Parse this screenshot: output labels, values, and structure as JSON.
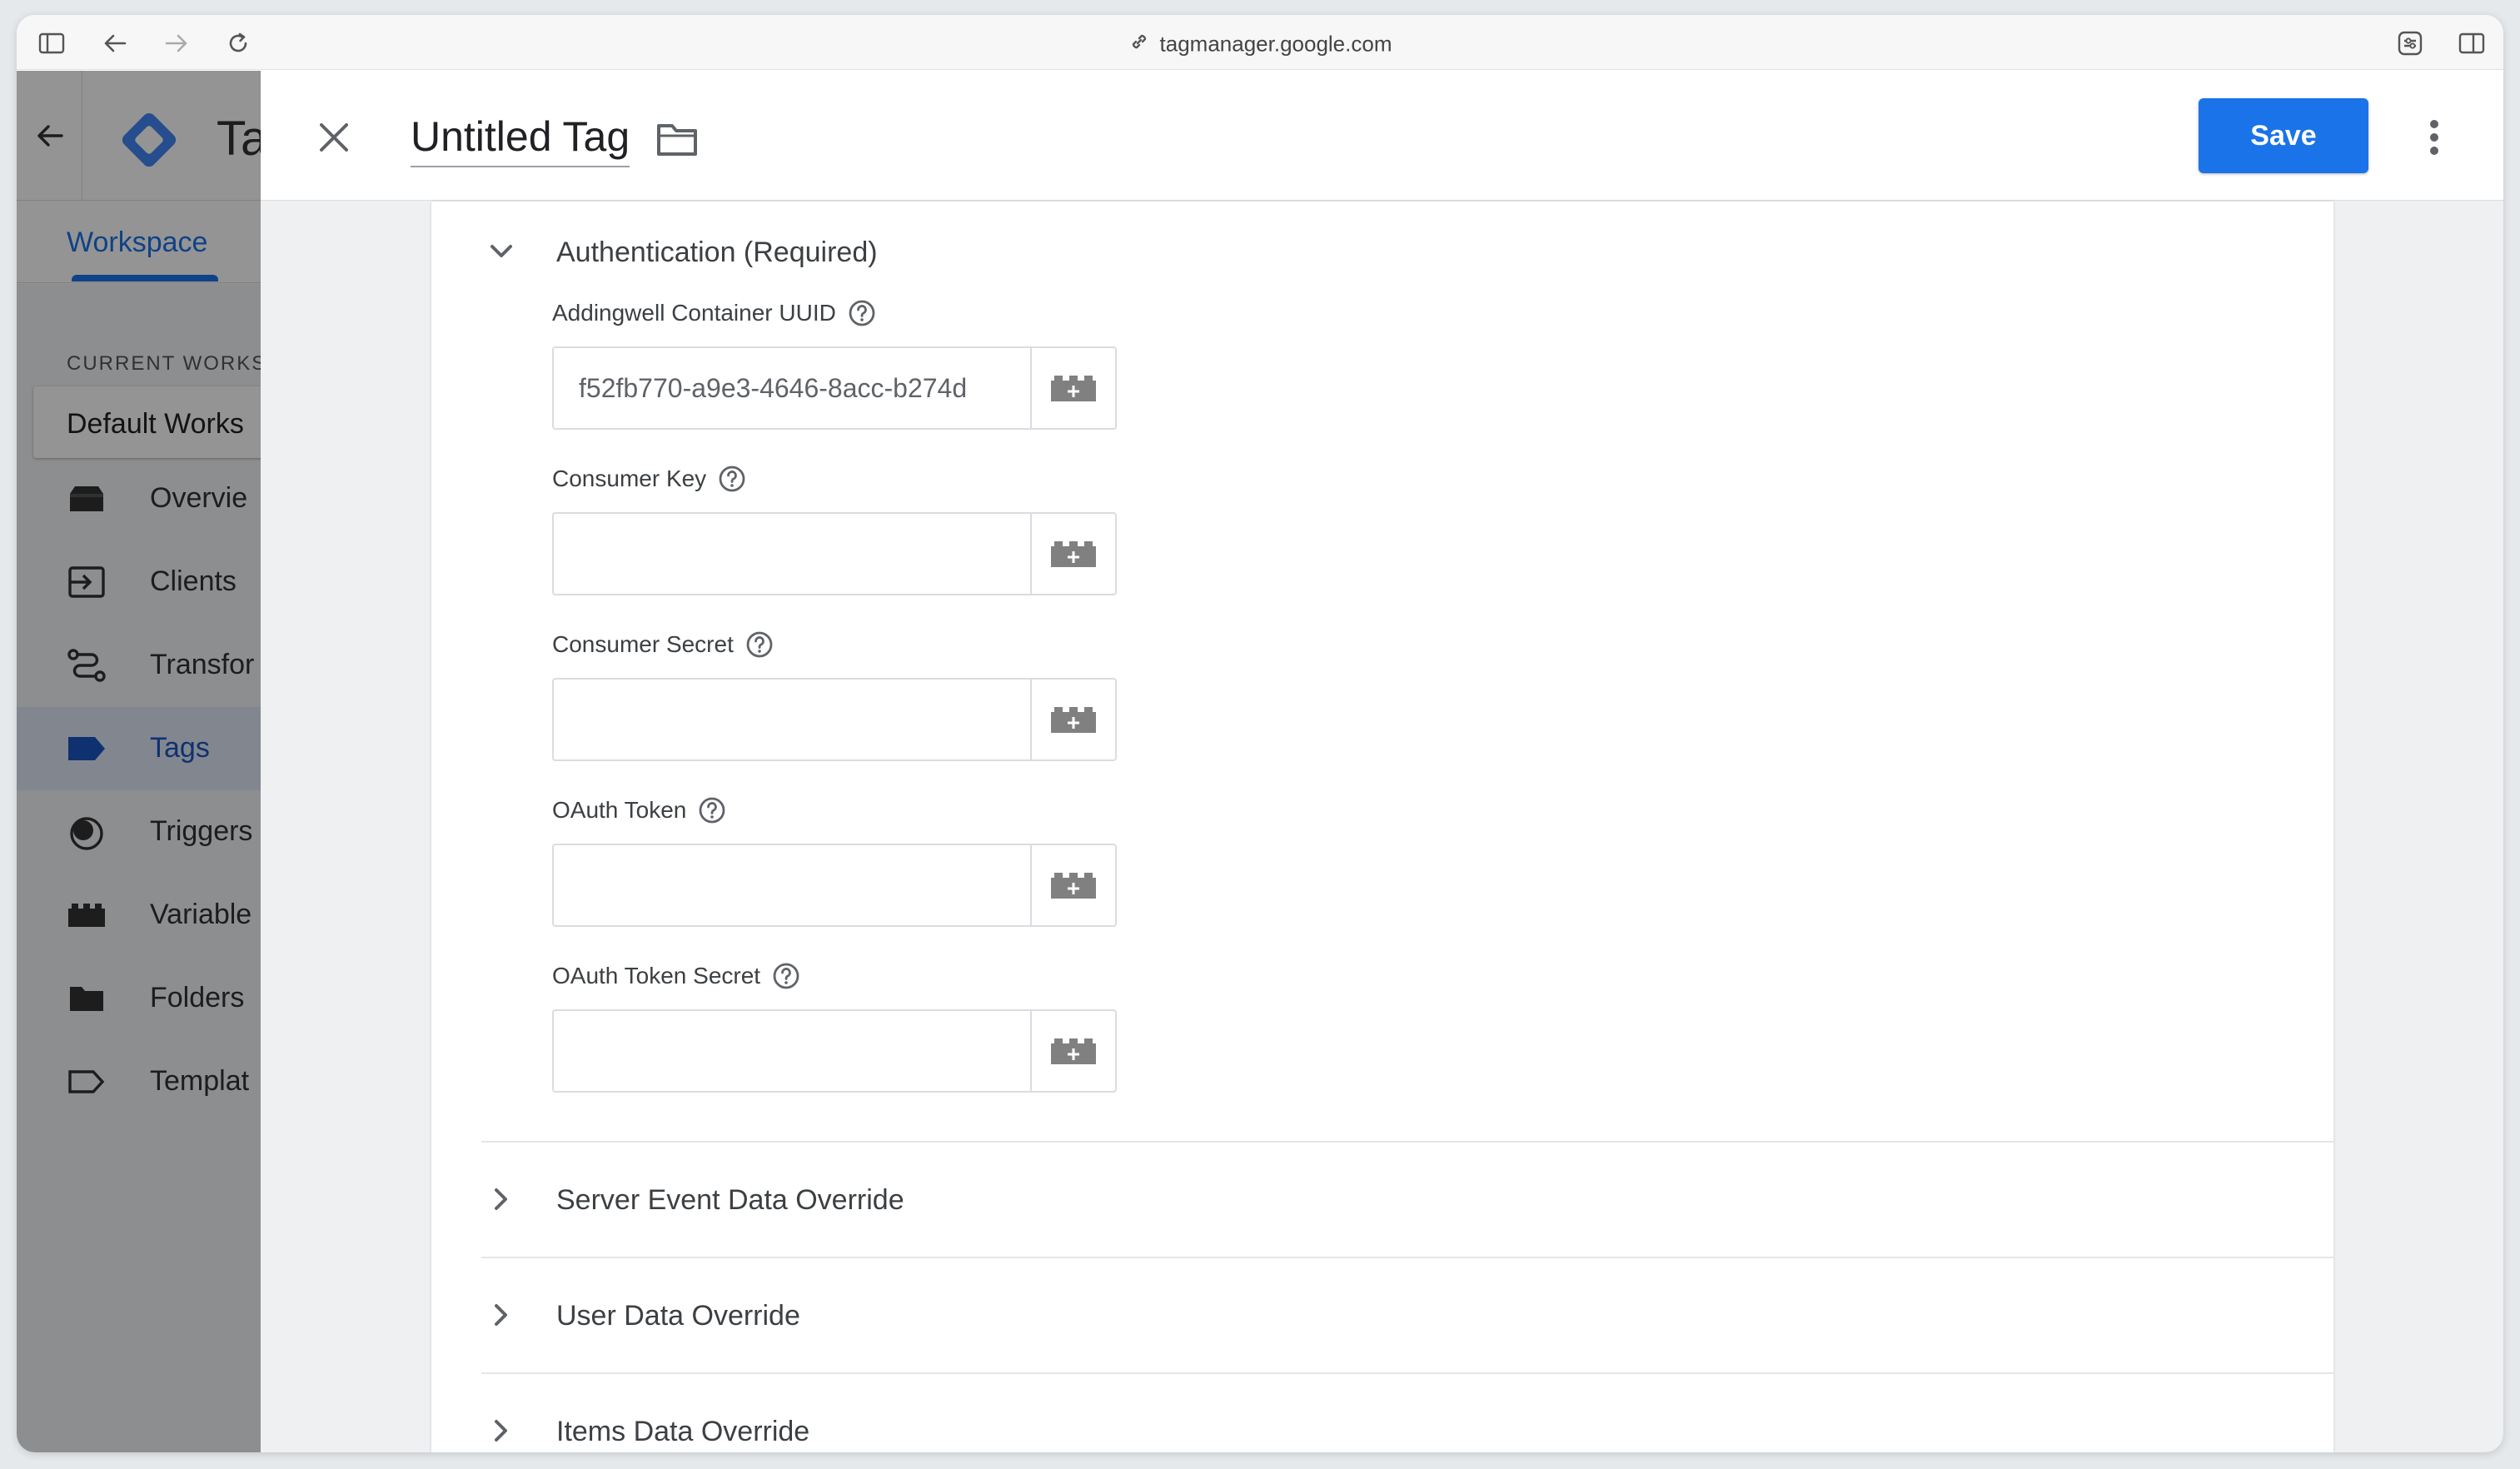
{
  "browser": {
    "url": "tagmanager.google.com"
  },
  "gtm": {
    "title": "Ta",
    "tab_workspace": "Workspace",
    "current_workspace_label": "CURRENT WORKS",
    "current_workspace_name": "Default Works",
    "nav": [
      {
        "label": "Overvie",
        "icon": "overview-icon",
        "active": false
      },
      {
        "label": "Clients",
        "icon": "clients-icon",
        "active": false
      },
      {
        "label": "Transfor",
        "icon": "transformations-icon",
        "active": false
      },
      {
        "label": "Tags",
        "icon": "tag-icon",
        "active": true
      },
      {
        "label": "Triggers",
        "icon": "triggers-icon",
        "active": false
      },
      {
        "label": "Variable",
        "icon": "variables-icon",
        "active": false
      },
      {
        "label": "Folders",
        "icon": "folder-icon",
        "active": false
      },
      {
        "label": "Templat",
        "icon": "templates-icon",
        "active": false
      }
    ]
  },
  "sheet": {
    "title": "Untitled Tag",
    "save_label": "Save",
    "colors": {
      "accent": "#1a73e8",
      "text": "#3c4043"
    }
  },
  "auth_section": {
    "title": "Authentication (Required)",
    "fields": [
      {
        "label": "Addingwell Container UUID",
        "value": "f52fb770-a9e3-4646-8acc-b274d",
        "placeholder": ""
      },
      {
        "label": "Consumer Key",
        "value": "",
        "placeholder": ""
      },
      {
        "label": "Consumer Secret",
        "value": "",
        "placeholder": ""
      },
      {
        "label": "OAuth Token",
        "value": "",
        "placeholder": ""
      },
      {
        "label": "OAuth Token Secret",
        "value": "",
        "placeholder": ""
      }
    ]
  },
  "collapsed_sections": [
    {
      "title": "Server Event Data Override"
    },
    {
      "title": "User Data Override"
    },
    {
      "title": "Items Data Override"
    }
  ]
}
